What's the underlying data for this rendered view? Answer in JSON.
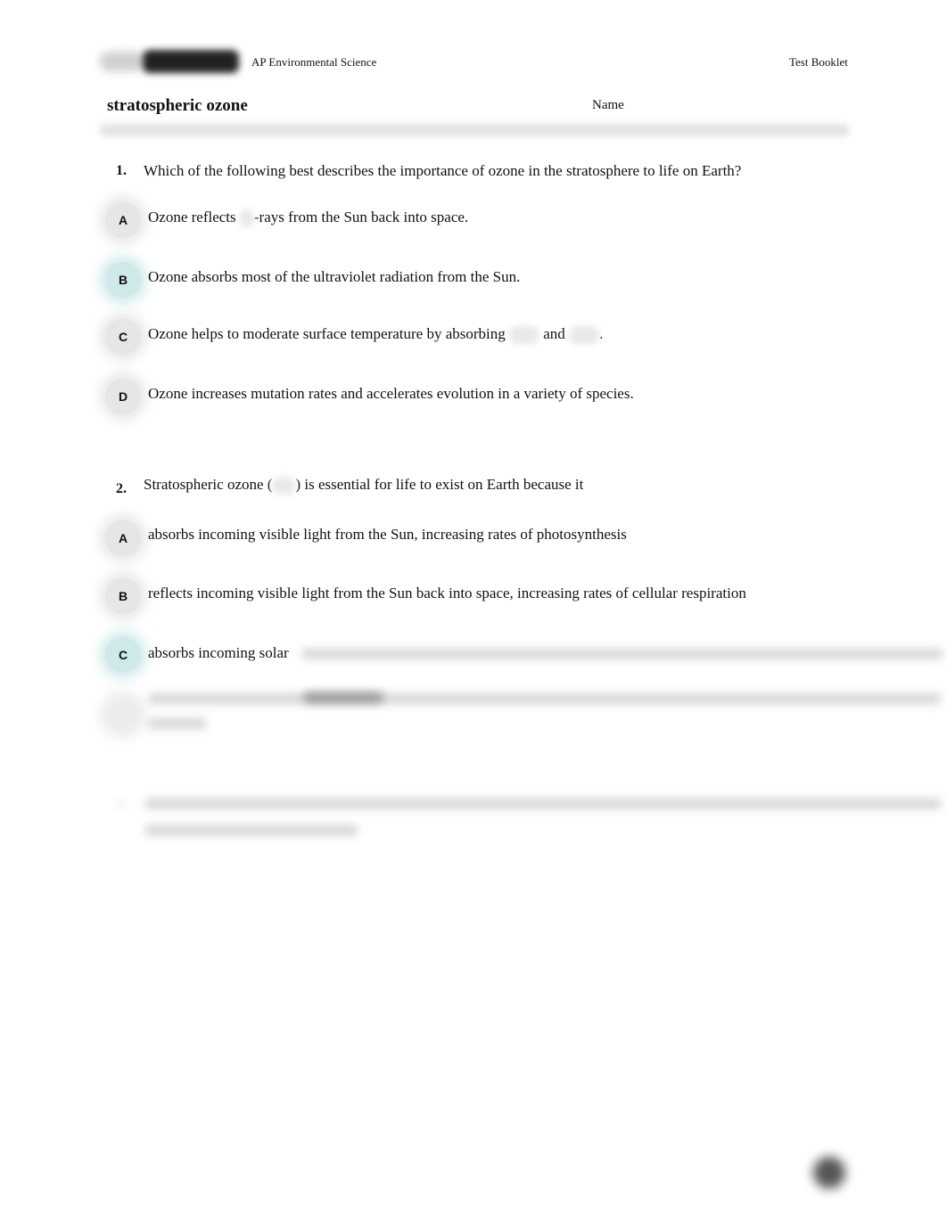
{
  "header": {
    "logo": "brand-logo",
    "subject": "AP Environmental Science",
    "booklet": "Test Booklet"
  },
  "page": {
    "title": "stratospheric ozone",
    "name_label": "Name"
  },
  "questions": [
    {
      "number": "1.",
      "stem": "Which of the following best describes the importance of ozone in the stratosphere to life on Earth?",
      "options": [
        {
          "letter": "A",
          "text_before": "Ozone reflects ",
          "text_after": "-rays from the Sun back into space.",
          "highlighted": false
        },
        {
          "letter": "B",
          "text": "Ozone absorbs most of the ultraviolet radiation from the Sun.",
          "highlighted": true
        },
        {
          "letter": "C",
          "text_before": "Ozone helps to moderate surface temperature by absorbing ",
          "text_mid": " and ",
          "text_after": ".",
          "highlighted": false
        },
        {
          "letter": "D",
          "text": "Ozone increases mutation rates and accelerates evolution in a variety of species.",
          "highlighted": false
        }
      ]
    },
    {
      "number": "2.",
      "stem_before": "Stratospheric ozone (",
      "stem_after": ") is essential for life to exist on Earth because it",
      "options": [
        {
          "letter": "A",
          "text": "absorbs incoming visible light from the Sun, increasing rates of photosynthesis",
          "highlighted": false
        },
        {
          "letter": "B",
          "text": "reflects incoming visible light from the Sun back into space, increasing rates of cellular respiration",
          "highlighted": false
        },
        {
          "letter": "C",
          "text": "absorbs incoming solar",
          "highlighted": true
        },
        {
          "letter": "D",
          "text": "",
          "highlighted": false
        }
      ]
    }
  ],
  "colors": {
    "correct_highlight": "#cde9ea",
    "badge": "#e4e4e4"
  }
}
